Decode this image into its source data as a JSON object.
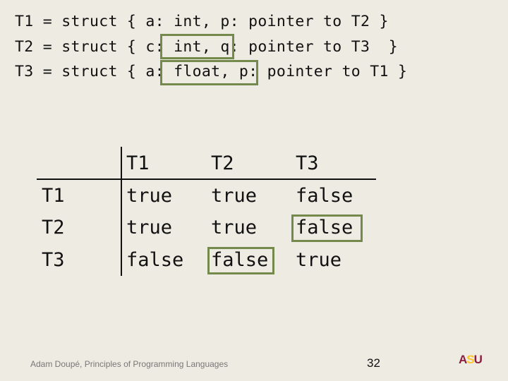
{
  "code": {
    "lines": [
      "T1 = struct { a: int, p: pointer to T2 }",
      "T2 = struct { c: int, q: pointer to T3  }",
      "T3 = struct { a: float, p: pointer to T1 }"
    ],
    "highlighted": [
      "c: int,",
      "a: float,"
    ]
  },
  "table": {
    "columns": [
      "T1",
      "T2",
      "T3"
    ],
    "rows": [
      {
        "label": "T1",
        "values": [
          "true",
          "true",
          "false"
        ]
      },
      {
        "label": "T2",
        "values": [
          "true",
          "true",
          "false"
        ]
      },
      {
        "label": "T3",
        "values": [
          "false",
          "false",
          "true"
        ]
      }
    ],
    "highlighted_cells": [
      [
        "T2",
        "T3"
      ],
      [
        "T3",
        "T2"
      ]
    ]
  },
  "footer": {
    "text": "Adam Doupé, Principles of Programming Languages",
    "page_number": "32",
    "logo": "ASU"
  },
  "colors": {
    "background": "#eeebe3",
    "highlight_box": "#748a4c",
    "logo_maroon": "#8c1d40",
    "logo_gold": "#ffc627"
  }
}
